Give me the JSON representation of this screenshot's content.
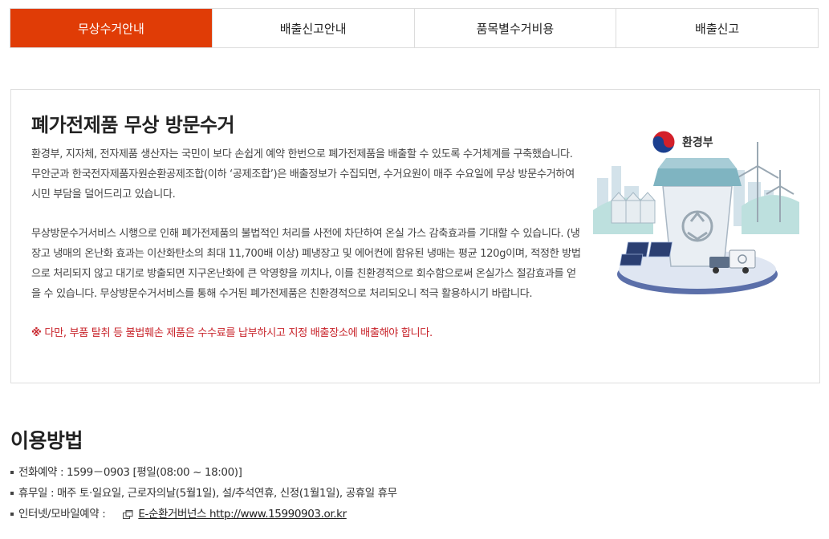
{
  "tabs": [
    {
      "label": "무상수거안내",
      "active": true
    },
    {
      "label": "배출신고안내",
      "active": false
    },
    {
      "label": "품목별수거비용",
      "active": false
    },
    {
      "label": "배출신고",
      "active": false
    }
  ],
  "intro": {
    "title": "폐가전제품 무상 방문수거",
    "paragraphs": [
      "환경부, 지자체, 전자제품 생산자는 국민이 보다 손쉽게 예약 한번으로 폐가전제품을 배출할 수 있도록 수거체계를 구축했습니다. 무안군과 한국전자제품자원순환공제조합(이하 ‘공제조합’)은 배출정보가 수집되면, 수거요원이 매주 수요일에 무상 방문수거하여 시민 부담을 덜어드리고 있습니다.",
      "무상방문수거서비스 시행으로 인해 폐가전제품의 불법적인 처리를 사전에 차단하여 온실 가스 감축효과를 기대할 수 있습니다. (냉장고 냉매의 온난화 효과는 이산화탄소의 최대 11,700배 이상) 폐냉장고 및 에어컨에 함유된 냉매는 평균 120g이며, 적정한 방법으로 처리되지 않고 대기로 방출되면 지구온난화에 큰 악영향을 끼치나, 이를 친환경적으로 회수함으로써 온실가스 절감효과를 얻을 수 있습니다. 무상방문수거서비스를 통해 수거된 폐가전제품은 친환경적으로 처리되오니 적극 활용하시기 바랍니다."
    ],
    "notice_mark": "※",
    "notice": "다만, 부품 탈취 등 불법훼손 제품은 수수료를 납부하시고 지정 배출장소에 배출해야 합니다.",
    "logo_text": "환경부"
  },
  "usage": {
    "title": "이용방법",
    "items": [
      {
        "text": "전화예약 : 1599－0903 [평일(08:00 ~ 18:00)]"
      },
      {
        "text": "휴무일 : 매주 토·일요일, 근로자의날(5월1일), 설/추석연휴, 신정(1월1일), 공휴일 휴무"
      },
      {
        "text": "인터넷/모바일예약 :",
        "link": "E-순환거버넌스 http://www.15990903.or.kr"
      }
    ]
  },
  "colors": {
    "accent": "#e03c06",
    "notice": "#c8242b"
  },
  "icons": [
    "mark-icon",
    "recycle-icon",
    "new-window-icon"
  ]
}
